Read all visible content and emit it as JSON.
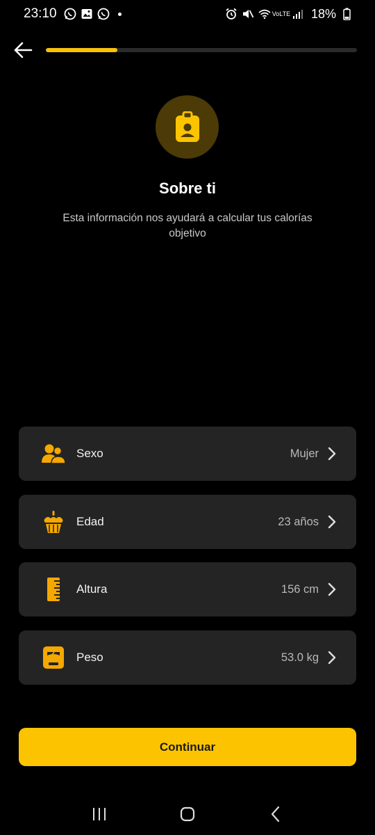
{
  "status_bar": {
    "time": "23:10",
    "network_label": "VoLTE",
    "battery": "18%"
  },
  "progress": {
    "fraction": 0.23
  },
  "header": {
    "title": "Sobre ti",
    "subtitle": "Esta información nos ayudará a calcular tus calorías objetivo"
  },
  "items": [
    {
      "label": "Sexo",
      "value": "Mujer",
      "icon": "people-icon"
    },
    {
      "label": "Edad",
      "value": "23 años",
      "icon": "cake-icon"
    },
    {
      "label": "Altura",
      "value": "156 cm",
      "icon": "ruler-icon"
    },
    {
      "label": "Peso",
      "value": "53.0 kg",
      "icon": "scale-icon"
    }
  ],
  "continue_label": "Continuar",
  "colors": {
    "accent": "#fcc400",
    "card_bg": "#242424",
    "background": "#000000",
    "avatar_bg": "#4c3b06"
  }
}
